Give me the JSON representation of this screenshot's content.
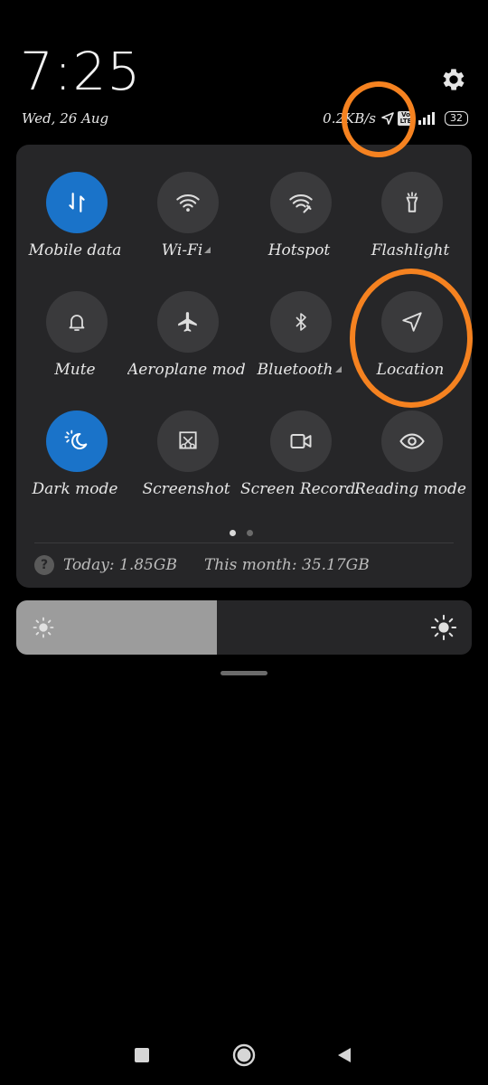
{
  "status": {
    "time": "7:25",
    "date": "Wed, 26 Aug",
    "net_speed": "0.2K",
    "net_unit": "B/s",
    "volte_top": "Vo",
    "volte_bottom": "LTE",
    "battery": "32"
  },
  "tiles": [
    {
      "label": "Mobile data",
      "icon": "mobile-data-icon",
      "active": true,
      "arrow": false
    },
    {
      "label": "Wi-Fi",
      "icon": "wifi-icon",
      "active": false,
      "arrow": true
    },
    {
      "label": "Hotspot",
      "icon": "hotspot-icon",
      "active": false,
      "arrow": false
    },
    {
      "label": "Flashlight",
      "icon": "flashlight-icon",
      "active": false,
      "arrow": false
    },
    {
      "label": "Mute",
      "icon": "bell-icon",
      "active": false,
      "arrow": false
    },
    {
      "label": "Aeroplane mode",
      "icon": "airplane-icon",
      "active": false,
      "arrow": false
    },
    {
      "label": "Bluetooth",
      "icon": "bluetooth-icon",
      "active": false,
      "arrow": true
    },
    {
      "label": "Location",
      "icon": "location-icon",
      "active": false,
      "arrow": false
    },
    {
      "label": "Dark mode",
      "icon": "dark-mode-icon",
      "active": true,
      "arrow": false
    },
    {
      "label": "Screenshot",
      "icon": "screenshot-icon",
      "active": false,
      "arrow": false
    },
    {
      "label": "Screen Recorder",
      "icon": "screen-recorder-icon",
      "active": false,
      "arrow": false
    },
    {
      "label": "Reading mode",
      "icon": "eye-icon",
      "active": false,
      "arrow": false
    }
  ],
  "pager": {
    "pages": 2,
    "current": 1
  },
  "usage": {
    "today": "Today: 1.85GB",
    "month": "This month: 35.17GB"
  },
  "brightness": {
    "level_percent": 44
  },
  "colors": {
    "accent_active": "#1a73c9",
    "tile_inactive": "#3a3a3c",
    "panel_bg": "#262628",
    "annotation_ring": "#f58220"
  }
}
